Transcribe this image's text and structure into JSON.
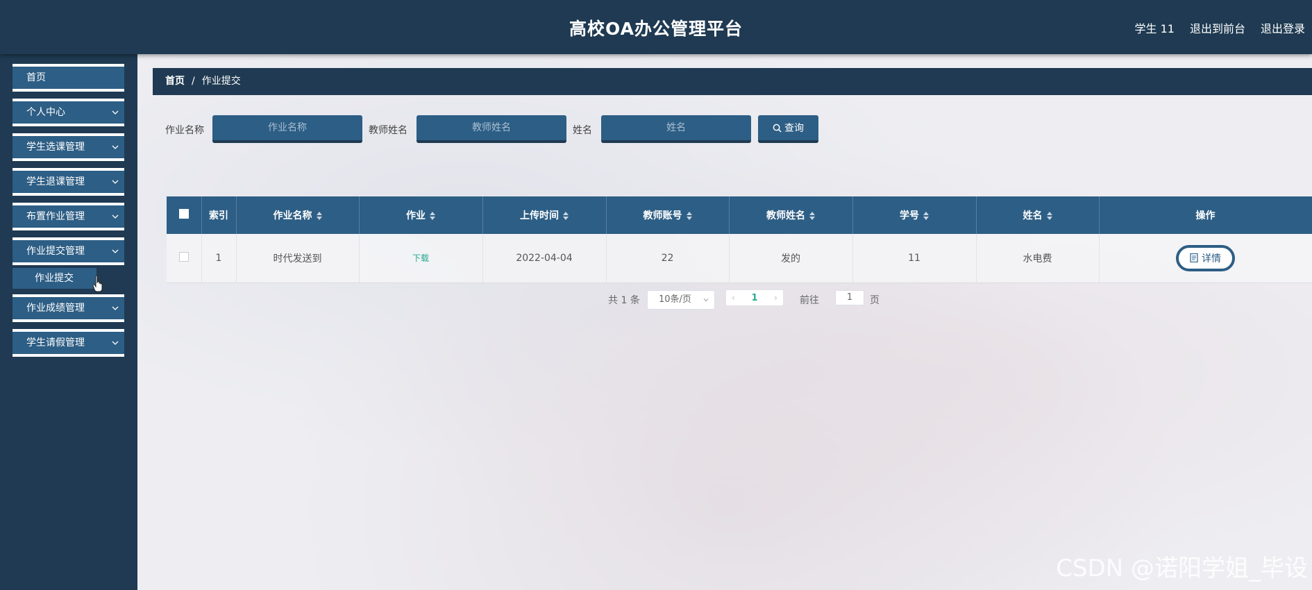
{
  "header": {
    "title": "高校OA办公管理平台",
    "user_label": "学生 11",
    "exit_front_label": "退出到前台",
    "logout_label": "退出登录"
  },
  "sidebar": {
    "items": [
      {
        "label": "首页",
        "has_children": false
      },
      {
        "label": "个人中心",
        "has_children": true
      },
      {
        "label": "学生选课管理",
        "has_children": true
      },
      {
        "label": "学生退课管理",
        "has_children": true
      },
      {
        "label": "布置作业管理",
        "has_children": true
      },
      {
        "label": "作业提交管理",
        "has_children": true
      },
      {
        "label": "作业成绩管理",
        "has_children": true
      },
      {
        "label": "学生请假管理",
        "has_children": true
      }
    ],
    "submenu_active": "作业提交"
  },
  "breadcrumb": {
    "home": "首页",
    "separator": "/",
    "current": "作业提交"
  },
  "search": {
    "homework_name_label": "作业名称",
    "homework_name_placeholder": "作业名称",
    "teacher_name_label": "教师姓名",
    "teacher_name_placeholder": "教师姓名",
    "name_label": "姓名",
    "name_placeholder": "姓名",
    "query_button": "查询"
  },
  "table": {
    "headers": [
      "索引",
      "作业名称",
      "作业",
      "上传时间",
      "教师账号",
      "教师姓名",
      "学号",
      "姓名",
      "操作"
    ],
    "rows": [
      {
        "index": "1",
        "homework_name": "时代发送到",
        "homework": "下载",
        "upload_time": "2022-04-04",
        "teacher_account": "22",
        "teacher_name": "发的",
        "student_id": "11",
        "name": "水电费",
        "action": "详情"
      }
    ]
  },
  "pagination": {
    "total": "共 1 条",
    "page_size": "10条/页",
    "current_page": "1",
    "goto_label": "前往",
    "goto_value": "1",
    "page_suffix": "页"
  },
  "watermark": "CSDN @诺阳学姐_毕设",
  "colors": {
    "header_bg": "#1f3a52",
    "accent": "#2d5e85",
    "link": "#27a88f"
  }
}
